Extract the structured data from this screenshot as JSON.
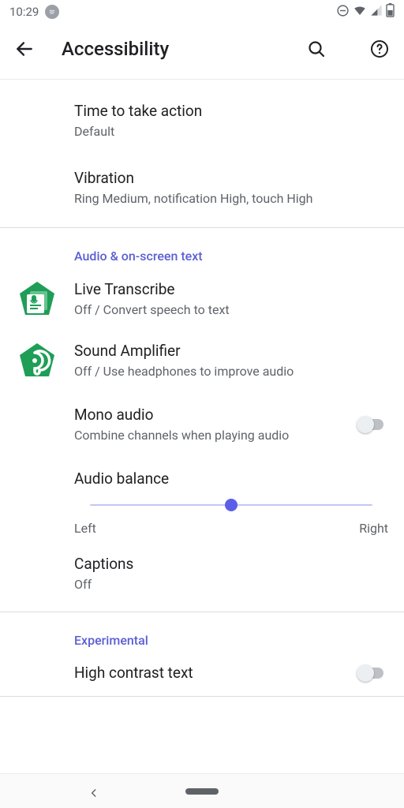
{
  "status": {
    "time": "10:29"
  },
  "header": {
    "title": "Accessibility"
  },
  "rows": {
    "time_to_take_action": {
      "title": "Time to take action",
      "sub": "Default"
    },
    "vibration": {
      "title": "Vibration",
      "sub": "Ring Medium, notification High, touch High"
    },
    "live_transcribe": {
      "title": "Live Transcribe",
      "sub": "Off / Convert speech to text"
    },
    "sound_amplifier": {
      "title": "Sound Amplifier",
      "sub": "Off / Use headphones to improve audio"
    },
    "mono_audio": {
      "title": "Mono audio",
      "sub": "Combine channels when playing audio"
    },
    "audio_balance": {
      "title": "Audio balance",
      "left": "Left",
      "right": "Right"
    },
    "captions": {
      "title": "Captions",
      "sub": "Off"
    },
    "high_contrast": {
      "title": "High contrast text"
    }
  },
  "sections": {
    "audio": "Audio & on-screen text",
    "experimental": "Experimental"
  }
}
